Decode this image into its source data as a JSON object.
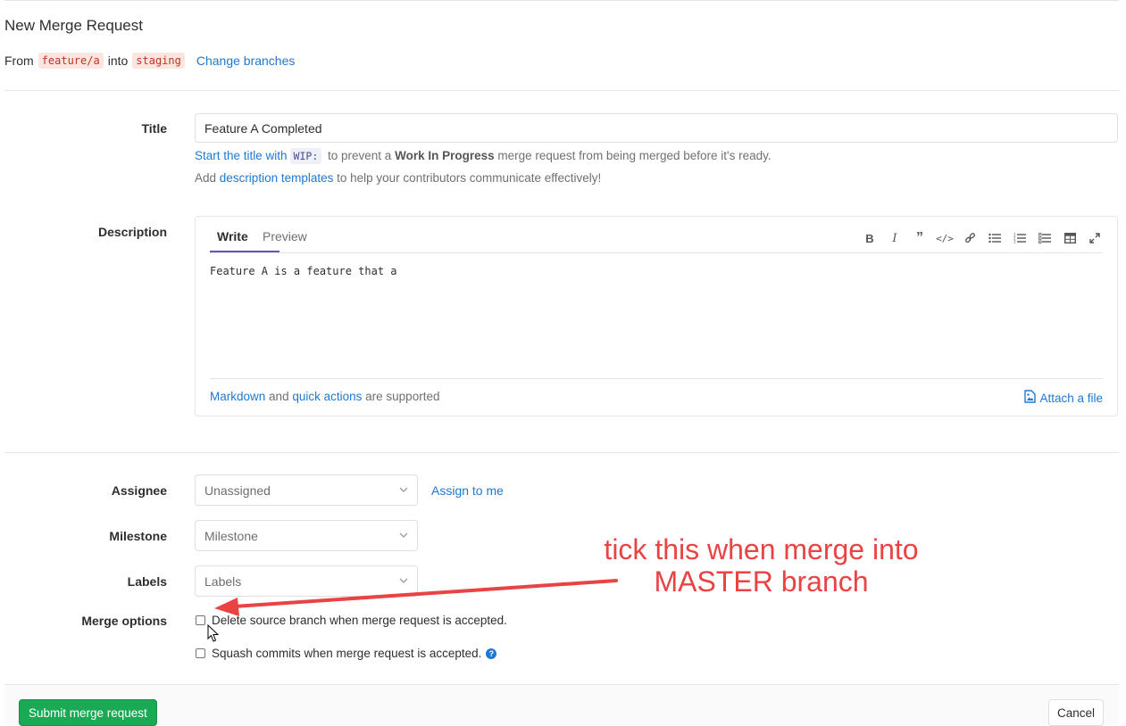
{
  "header": {
    "title": "New Merge Request",
    "from_label": "From",
    "source_branch": "feature/a",
    "into_label": "into",
    "target_branch": "staging",
    "change_branches": "Change branches"
  },
  "title_field": {
    "label": "Title",
    "value": "Feature A Completed",
    "hint_link": "Start the title with",
    "hint_code": "WIP:",
    "hint_mid": "to prevent a",
    "hint_bold": "Work In Progress",
    "hint_end": "merge request from being merged before it's ready.",
    "templates_pre": "Add",
    "templates_link": "description templates",
    "templates_post": "to help your contributors communicate effectively!"
  },
  "description": {
    "label": "Description",
    "tab_write": "Write",
    "tab_preview": "Preview",
    "text": "Feature A is a feature that a",
    "footer_markdown": "Markdown",
    "footer_and": "and",
    "footer_quick_actions": "quick actions",
    "footer_supported": "are supported",
    "attach_file": "Attach a file",
    "toolbar": [
      "bold-icon",
      "italic-icon",
      "quote-icon",
      "code-icon",
      "link-icon",
      "bullet-list-icon",
      "numbered-list-icon",
      "task-list-icon",
      "table-icon",
      "fullscreen-icon"
    ]
  },
  "assignee": {
    "label": "Assignee",
    "value": "Unassigned",
    "assign_to_me": "Assign to me"
  },
  "milestone": {
    "label": "Milestone",
    "value": "Milestone"
  },
  "labels": {
    "label": "Labels",
    "value": "Labels"
  },
  "merge_options": {
    "label": "Merge options",
    "delete_source": "Delete source branch when merge request is accepted.",
    "squash": "Squash commits when merge request is accepted."
  },
  "actions": {
    "submit": "Submit merge request",
    "cancel": "Cancel"
  },
  "annotation": {
    "line1": "tick this when merge into",
    "line2": "MASTER branch"
  },
  "colors": {
    "link": "#1f78d1",
    "submit": "#1aaa55",
    "annotation": "#ea4343",
    "tab_underline": "#6b4fbb"
  }
}
